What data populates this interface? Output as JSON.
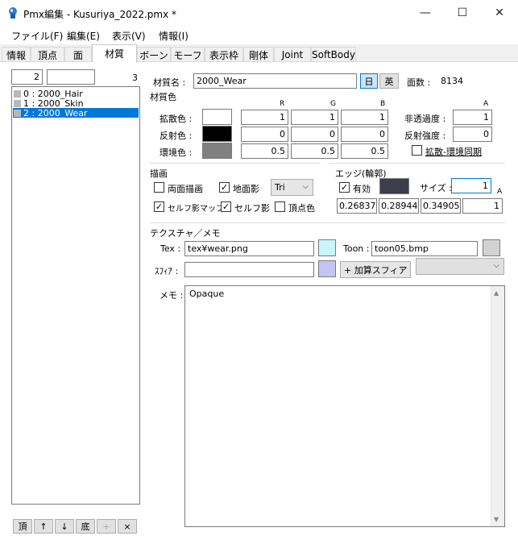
{
  "window": {
    "title": "Pmx編集 - Kusuriya_2022.pmx *",
    "minimize": "—",
    "maximize": "☐",
    "close": "✕"
  },
  "menu": [
    "ファイル(F)",
    "編集(E)",
    "表示(V)",
    "情報(I)"
  ],
  "tabs": [
    {
      "label": "情報",
      "active": false
    },
    {
      "label": "頂点",
      "active": false
    },
    {
      "label": "面",
      "active": false
    },
    {
      "label": "材質",
      "active": true
    },
    {
      "label": "ボーン",
      "active": false
    },
    {
      "label": "モーフ",
      "active": false
    },
    {
      "label": "表示枠",
      "active": false
    },
    {
      "label": "剛体",
      "active": false
    },
    {
      "label": "Joint",
      "active": false
    },
    {
      "label": "SoftBody",
      "active": false
    }
  ],
  "list_panel": {
    "index_value": "2",
    "search_value": "",
    "count": "3",
    "items": [
      {
        "label": "0 : 2000_Hair",
        "selected": false
      },
      {
        "label": "1 : 2000_Skin",
        "selected": false
      },
      {
        "label": "2 : 2000_Wear",
        "selected": true
      }
    ],
    "buttons": {
      "top": "頂",
      "up": "↑",
      "down": "↓",
      "bottom": "底",
      "add": "+",
      "delete": "×"
    }
  },
  "material": {
    "name_label": "材質名 :",
    "name_value": "2000_Wear",
    "lang_jp": "日",
    "lang_en": "英",
    "face_count_label": "面数 :",
    "face_count_value": "8134",
    "color_section": "材質色",
    "col_r": "R",
    "col_g": "G",
    "col_b": "B",
    "col_a": "A",
    "diffuse_label": "拡散色 :",
    "diffuse": {
      "r": "1",
      "g": "1",
      "b": "1",
      "swatch": "#ffffff"
    },
    "alpha_label": "非透過度 :",
    "alpha_value": "1",
    "specular_label": "反射色 :",
    "specular": {
      "r": "0",
      "g": "0",
      "b": "0",
      "swatch": "#000000"
    },
    "specular_power_label": "反射強度 :",
    "specular_power_value": "0",
    "ambient_label": "環境色 :",
    "ambient": {
      "r": "0.5",
      "g": "0.5",
      "b": "0.5",
      "swatch": "#808080"
    },
    "sync_label": "拡散-環境同期",
    "sync_checked": false
  },
  "drawing": {
    "section": "描画",
    "double_sided": {
      "label": "両面描画",
      "checked": false
    },
    "ground_shadow": {
      "label": "地面影",
      "checked": true
    },
    "primitive_value": "Tri",
    "self_shadow_map": {
      "label": "セルフ影マップ",
      "checked": true
    },
    "self_shadow": {
      "label": "セルフ影",
      "checked": true
    },
    "vertex_color": {
      "label": "頂点色",
      "checked": false
    }
  },
  "edge": {
    "section": "エッジ(輪郭)",
    "enabled": {
      "label": "有効",
      "checked": true
    },
    "swatch": "#3c3f4a",
    "size_label": "サイズ :",
    "size_value": "1",
    "col_a": "A",
    "r": "0.268378",
    "g": "0.289440",
    "b": "0.349056",
    "a": "1"
  },
  "texture": {
    "section": "テクスチャ／メモ",
    "tex_label": "Tex :",
    "tex_value": "tex¥wear.png",
    "tex_swatch": "#c8f4fc",
    "toon_label": "Toon :",
    "toon_value": "toon05.bmp",
    "toon_swatch": "#d2d2d2",
    "sphere_label": "ｽﾌｨｱ :",
    "sphere_value": "",
    "sphere_swatch": "#c4c4f4",
    "sphere_mode_value": "+ 加算スフィア",
    "toon_select_value": ""
  },
  "memo": {
    "label": "メモ :",
    "value": "Opaque"
  }
}
